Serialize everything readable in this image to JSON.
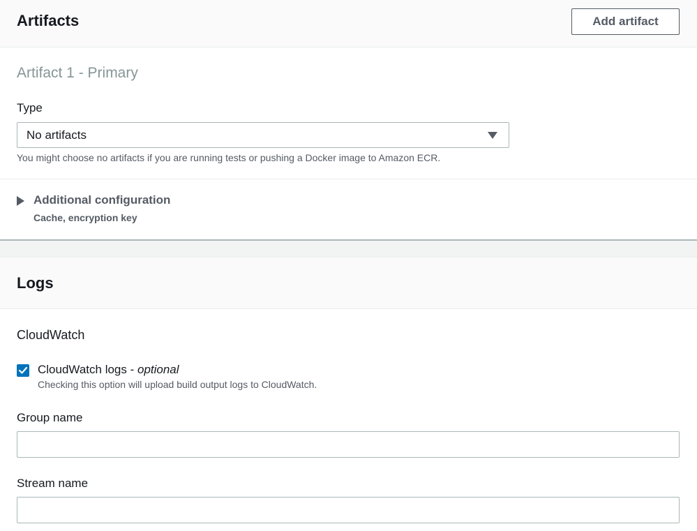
{
  "artifacts": {
    "section_title": "Artifacts",
    "add_button": "Add artifact",
    "artifact_title": "Artifact 1 - Primary",
    "type_label": "Type",
    "type_value": "No artifacts",
    "type_hint": "You might choose no artifacts if you are running tests or pushing a Docker image to Amazon ECR.",
    "additional_config": {
      "title": "Additional configuration",
      "description": "Cache, encryption key"
    }
  },
  "logs": {
    "section_title": "Logs",
    "cloudwatch_heading": "CloudWatch",
    "cloudwatch_logs": {
      "label": "CloudWatch logs",
      "separator": " - ",
      "optional": "optional",
      "description": "Checking this option will upload build output logs to CloudWatch.",
      "checked": true
    },
    "group_name_label": "Group name",
    "group_name_value": "",
    "stream_name_label": "Stream name",
    "stream_name_value": ""
  },
  "colors": {
    "accent": "#0073bb",
    "header_bg": "#fafafa",
    "border": "#aab7b8",
    "muted_text": "#545b64"
  },
  "icons": {
    "select_caret": "caret-down-icon",
    "expander": "caret-right-icon",
    "checkbox": "checkmark-icon"
  }
}
